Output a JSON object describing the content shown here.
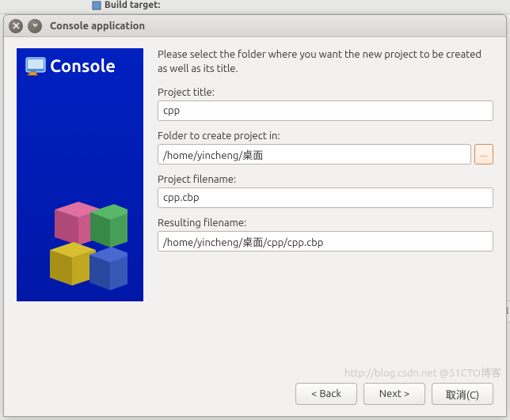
{
  "background": {
    "build_target_label": "Build target:"
  },
  "titlebar": {
    "title": "Console application"
  },
  "side": {
    "logo_name": "console-app-icon",
    "title": "Console"
  },
  "form": {
    "instruction": "Please select the folder where you want the new project to be created as well as its title.",
    "project_title": {
      "label": "Project title:",
      "value": "cpp"
    },
    "folder": {
      "label": "Folder to create project in:",
      "value": "/home/yincheng/桌面",
      "browse": "..."
    },
    "project_filename": {
      "label": "Project filename:",
      "value": "cpp.cbp"
    },
    "resulting_filename": {
      "label": "Resulting filename:",
      "value": "/home/yincheng/桌面/cpp/cpp.cbp"
    }
  },
  "buttons": {
    "back": "< Back",
    "next": "Next >",
    "cancel": "取消(C)"
  },
  "watermark": "http://blog.csdn.net @51CTO博客",
  "right_hint": "d l"
}
